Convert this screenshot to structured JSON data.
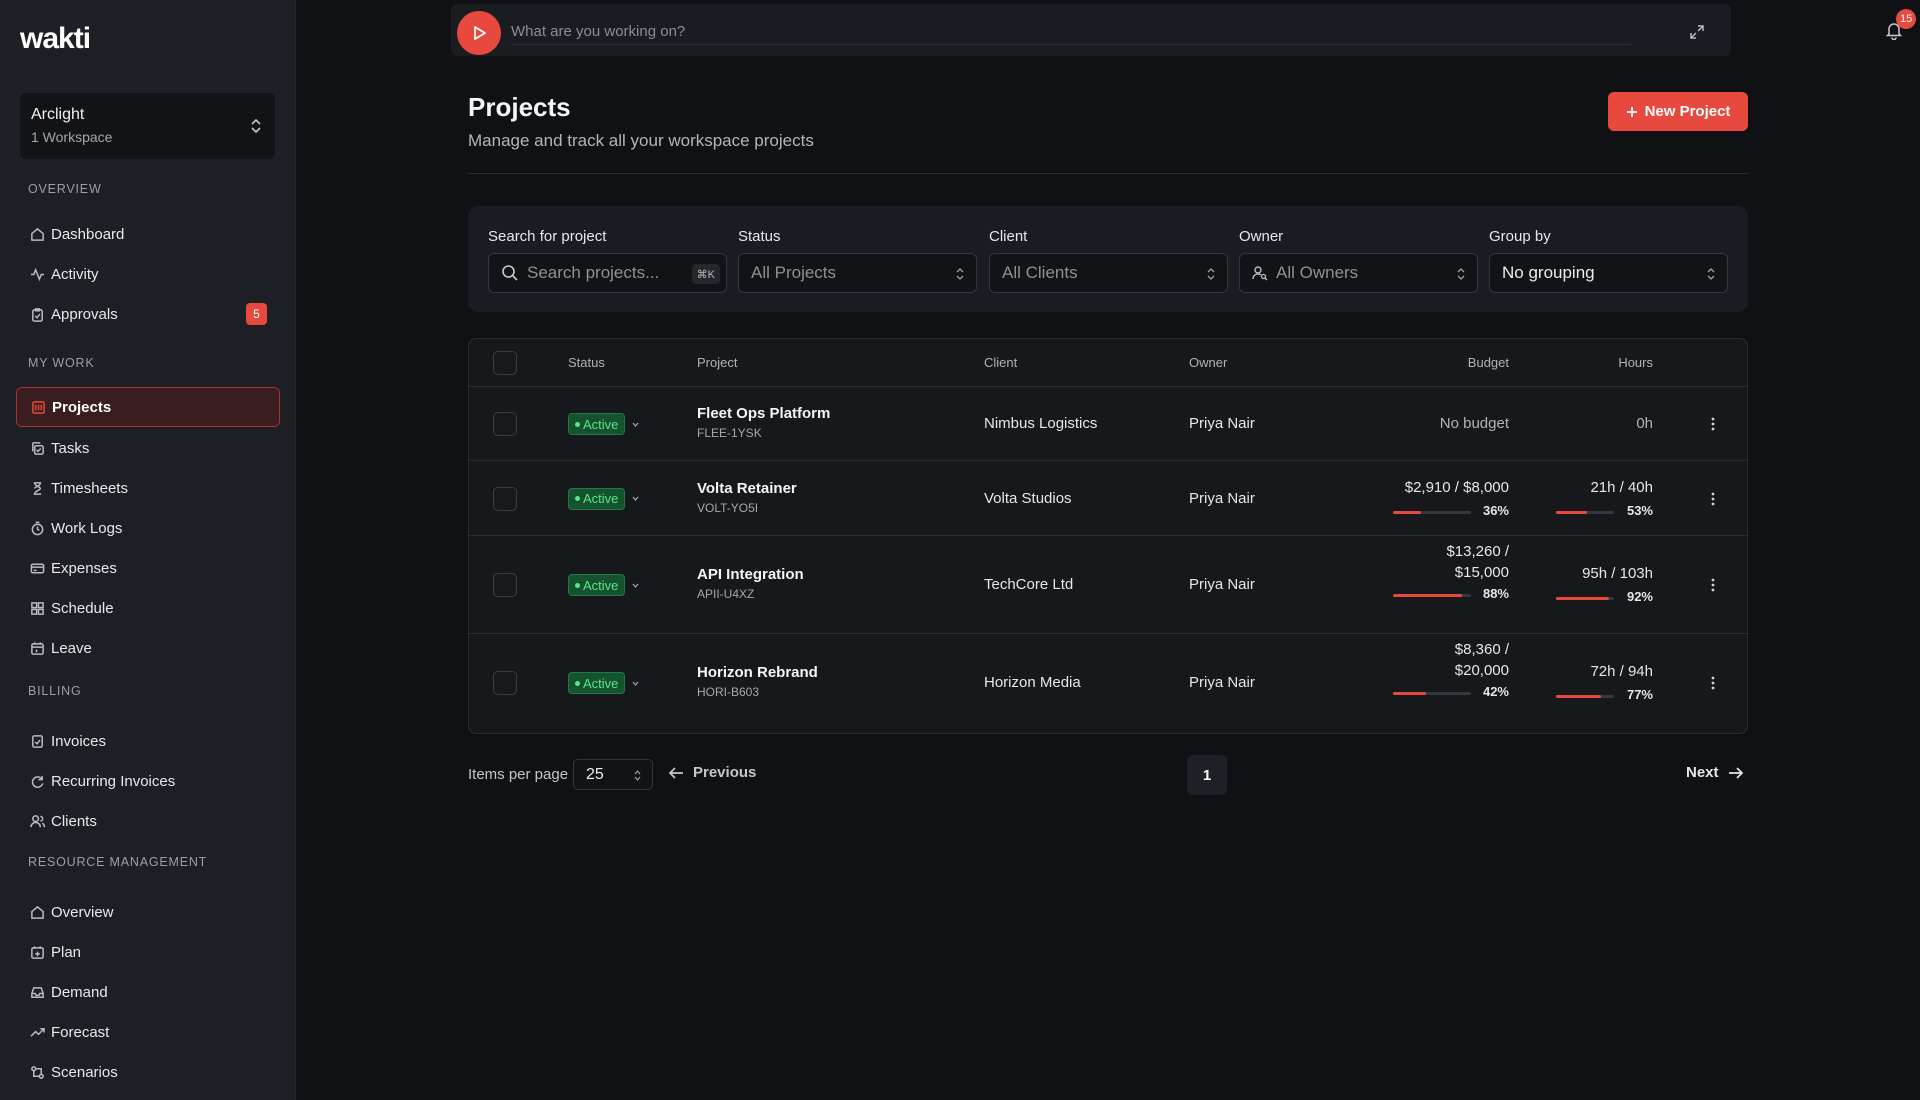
{
  "app": {
    "logo": "wakti"
  },
  "workspace": {
    "name": "Arclight",
    "sub": "1 Workspace"
  },
  "sidebar": {
    "sections": [
      {
        "title": "OVERVIEW",
        "items": [
          {
            "label": "Dashboard",
            "icon": "home-icon"
          },
          {
            "label": "Activity",
            "icon": "activity-icon"
          },
          {
            "label": "Approvals",
            "icon": "clipboard-check-icon",
            "badge": "5"
          }
        ]
      },
      {
        "title": "MY WORK",
        "items": [
          {
            "label": "Projects",
            "icon": "briefcase-icon",
            "active": true
          },
          {
            "label": "Tasks",
            "icon": "copy-check-icon"
          },
          {
            "label": "Timesheets",
            "icon": "hourglass-icon"
          },
          {
            "label": "Work Logs",
            "icon": "clock-icon"
          },
          {
            "label": "Expenses",
            "icon": "wallet-icon"
          },
          {
            "label": "Schedule",
            "icon": "grid-icon"
          },
          {
            "label": "Leave",
            "icon": "calendar-icon"
          }
        ]
      },
      {
        "title": "BILLING",
        "items": [
          {
            "label": "Invoices",
            "icon": "file-check-icon"
          },
          {
            "label": "Recurring Invoices",
            "icon": "refresh-icon"
          },
          {
            "label": "Clients",
            "icon": "users-icon"
          }
        ]
      },
      {
        "title": "RESOURCE MANAGEMENT",
        "items": [
          {
            "label": "Overview",
            "icon": "home-icon"
          },
          {
            "label": "Plan",
            "icon": "calendar-plus-icon"
          },
          {
            "label": "Demand",
            "icon": "inbox-icon"
          },
          {
            "label": "Forecast",
            "icon": "trending-up-icon"
          },
          {
            "label": "Scenarios",
            "icon": "git-branch-icon"
          }
        ]
      }
    ]
  },
  "timer": {
    "placeholder": "What are you working on?"
  },
  "notifications": {
    "count": "15"
  },
  "header": {
    "title": "Projects",
    "subtitle": "Manage and track all your workspace projects",
    "new_button": "New Project"
  },
  "filters": {
    "search": {
      "label": "Search for project",
      "placeholder": "Search projects...",
      "shortcut": "⌘K"
    },
    "status": {
      "label": "Status",
      "value": "All Projects"
    },
    "client": {
      "label": "Client",
      "value": "All Clients"
    },
    "owner": {
      "label": "Owner",
      "value": "All Owners"
    },
    "group": {
      "label": "Group by",
      "value": "No grouping"
    }
  },
  "table": {
    "columns": {
      "status": "Status",
      "project": "Project",
      "client": "Client",
      "owner": "Owner",
      "budget": "Budget",
      "hours": "Hours"
    },
    "rows": [
      {
        "status": "Active",
        "name": "Fleet Ops Platform",
        "code": "FLEE-1YSK",
        "client": "Nimbus Logistics",
        "owner": "Priya Nair",
        "budget_text": "No budget",
        "budget_pct": null,
        "budget_pct_label": "",
        "hours_text": "0h",
        "hours_pct": null,
        "hours_pct_label": ""
      },
      {
        "status": "Active",
        "name": "Volta Retainer",
        "code": "VOLT-YO5I",
        "client": "Volta Studios",
        "owner": "Priya Nair",
        "budget_text": "$2,910 / $8,000",
        "budget_pct": 36,
        "budget_pct_label": "36%",
        "hours_text": "21h / 40h",
        "hours_pct": 53,
        "hours_pct_label": "53%"
      },
      {
        "status": "Active",
        "name": "API Integration",
        "code": "APII-U4XZ",
        "client": "TechCore Ltd",
        "owner": "Priya Nair",
        "budget_line1": "$13,260 /",
        "budget_line2": "$15,000",
        "budget_pct": 88,
        "budget_pct_label": "88%",
        "hours_text": "95h / 103h",
        "hours_pct": 92,
        "hours_pct_label": "92%"
      },
      {
        "status": "Active",
        "name": "Horizon Rebrand",
        "code": "HORI-B603",
        "client": "Horizon Media",
        "owner": "Priya Nair",
        "budget_line1": "$8,360 /",
        "budget_line2": "$20,000",
        "budget_pct": 42,
        "budget_pct_label": "42%",
        "hours_text": "72h / 94h",
        "hours_pct": 77,
        "hours_pct_label": "77%"
      }
    ]
  },
  "pagination": {
    "items_per_page_label": "Items per page",
    "items_per_page": "25",
    "previous": "Previous",
    "page": "1",
    "next": "Next"
  },
  "colors": {
    "accent": "#e8493f",
    "active_green": "#5be38d",
    "background": "#0f1115",
    "sidebar": "#1e1f24"
  }
}
